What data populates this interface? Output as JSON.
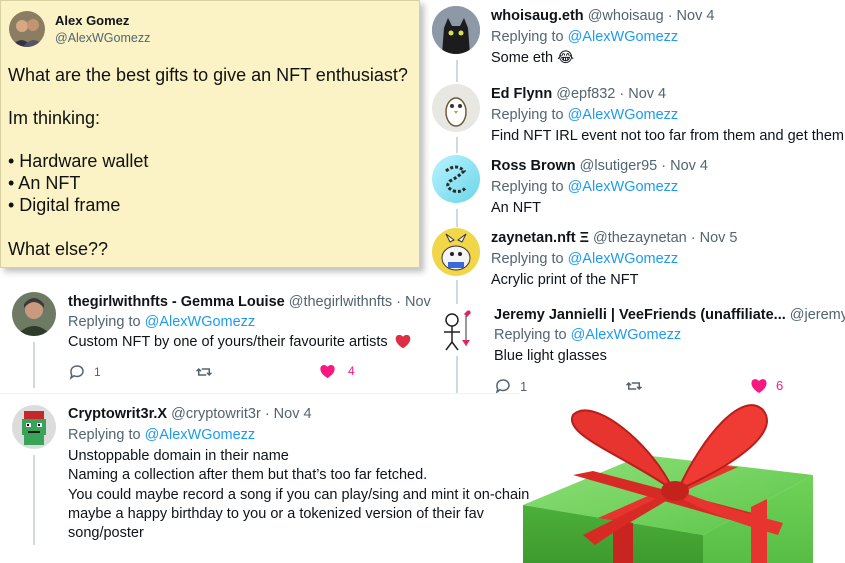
{
  "main_tweet": {
    "name": "Alex Gomez",
    "handle": "@AlexWGomezz",
    "text_lines": [
      "What are the best gifts to give an NFT enthusiast?",
      "Im thinking:",
      "• Hardware wallet",
      "• An NFT",
      "• Digital frame",
      "What else??"
    ]
  },
  "replies_right": [
    {
      "name": "whoisaug.eth",
      "handle": "@whoisaug",
      "date": "· Nov 4",
      "replying_prefix": "Replying to",
      "replying_to": "@AlexWGomezz",
      "text": "Some eth 😂"
    },
    {
      "name": "Ed Flynn",
      "handle": "@epf832",
      "date": "· Nov 4",
      "replying_prefix": "Replying to",
      "replying_to": "@AlexWGomezz",
      "text": "Find NFT IRL event not too far from them and get them"
    },
    {
      "name": "Ross Brown",
      "handle": "@lsutiger95",
      "date": "· Nov 4",
      "replying_prefix": "Replying to",
      "replying_to": "@AlexWGomezz",
      "text": "An NFT"
    },
    {
      "name": "zaynetan.nft Ξ",
      "handle": "@thezaynetan",
      "date": "· Nov 5",
      "replying_prefix": "Replying to",
      "replying_to": "@AlexWGomezz",
      "text": "Acrylic print of the NFT"
    },
    {
      "name": "Jeremy Jannielli | VeeFriends (unaffiliate...",
      "handle": "@jeremykr",
      "date": "",
      "replying_prefix": "Replying to",
      "replying_to": "@AlexWGomezz",
      "text": "Blue light glasses",
      "reply_count": "1",
      "like_count": "6"
    }
  ],
  "reply_gemma": {
    "name": "thegirlwithnfts - Gemma Louise",
    "handle": "@thegirlwithnfts",
    "date": "· Nov",
    "replying_prefix": "Replying to",
    "replying_to": "@AlexWGomezz",
    "text": "Custom NFT by one of yours/their favourite artists",
    "reply_count": "1",
    "like_count": "4"
  },
  "reply_crypto": {
    "name": "Cryptowrit3r.X",
    "handle": "@cryptowrit3r",
    "date": "· Nov 4",
    "replying_prefix": "Replying to",
    "replying_to": "@AlexWGomezz",
    "text_lines": [
      "Unstoppable domain in their name",
      "Naming a collection after them but that’s too far fetched.",
      "You could maybe record a song if you can play/sing and mint it on-chain",
      "maybe a happy birthday to you or a tokenized version of their fav",
      "song/poster"
    ]
  },
  "colors": {
    "link": "#1d9bf0",
    "like": "#f91880",
    "card": "#fbf3c5",
    "gift_box": "#5fc74a",
    "ribbon": "#e8342e"
  },
  "icons": [
    "reply-icon",
    "retweet-icon",
    "heart-icon",
    "red-heart-emoji",
    "laughing-emoji",
    "gift-image"
  ]
}
